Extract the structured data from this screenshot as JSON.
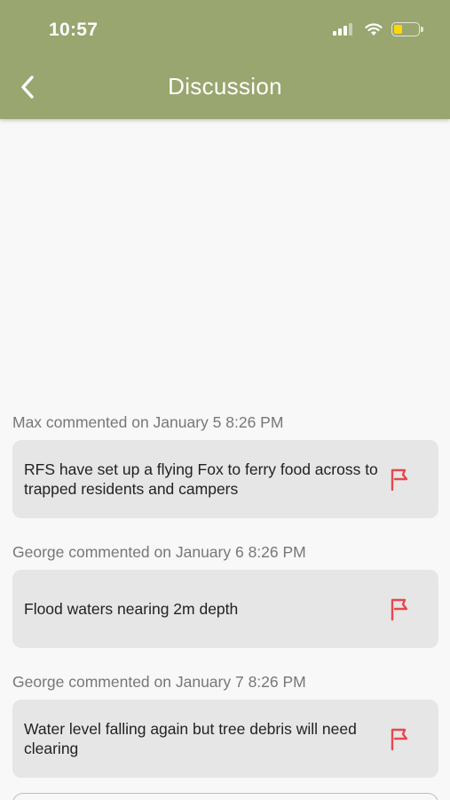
{
  "status_bar": {
    "time": "10:57",
    "battery_level": 0.35
  },
  "header": {
    "title": "Discussion",
    "background_color": "#99a66f"
  },
  "comments": [
    {
      "meta": "Max commented on January 5 8:26 PM",
      "text": "RFS have set up a flying Fox to ferry food across to trapped residents and campers"
    },
    {
      "meta": "George commented on January 6 8:26 PM",
      "text": "Flood waters nearing 2m depth"
    },
    {
      "meta": "George commented on January 7 8:26 PM",
      "text": "Water level falling again but tree debris will need clearing"
    }
  ],
  "icons": {
    "flag_color": "#e5484d",
    "back": "chevron-left-icon",
    "flag": "flag-icon"
  }
}
